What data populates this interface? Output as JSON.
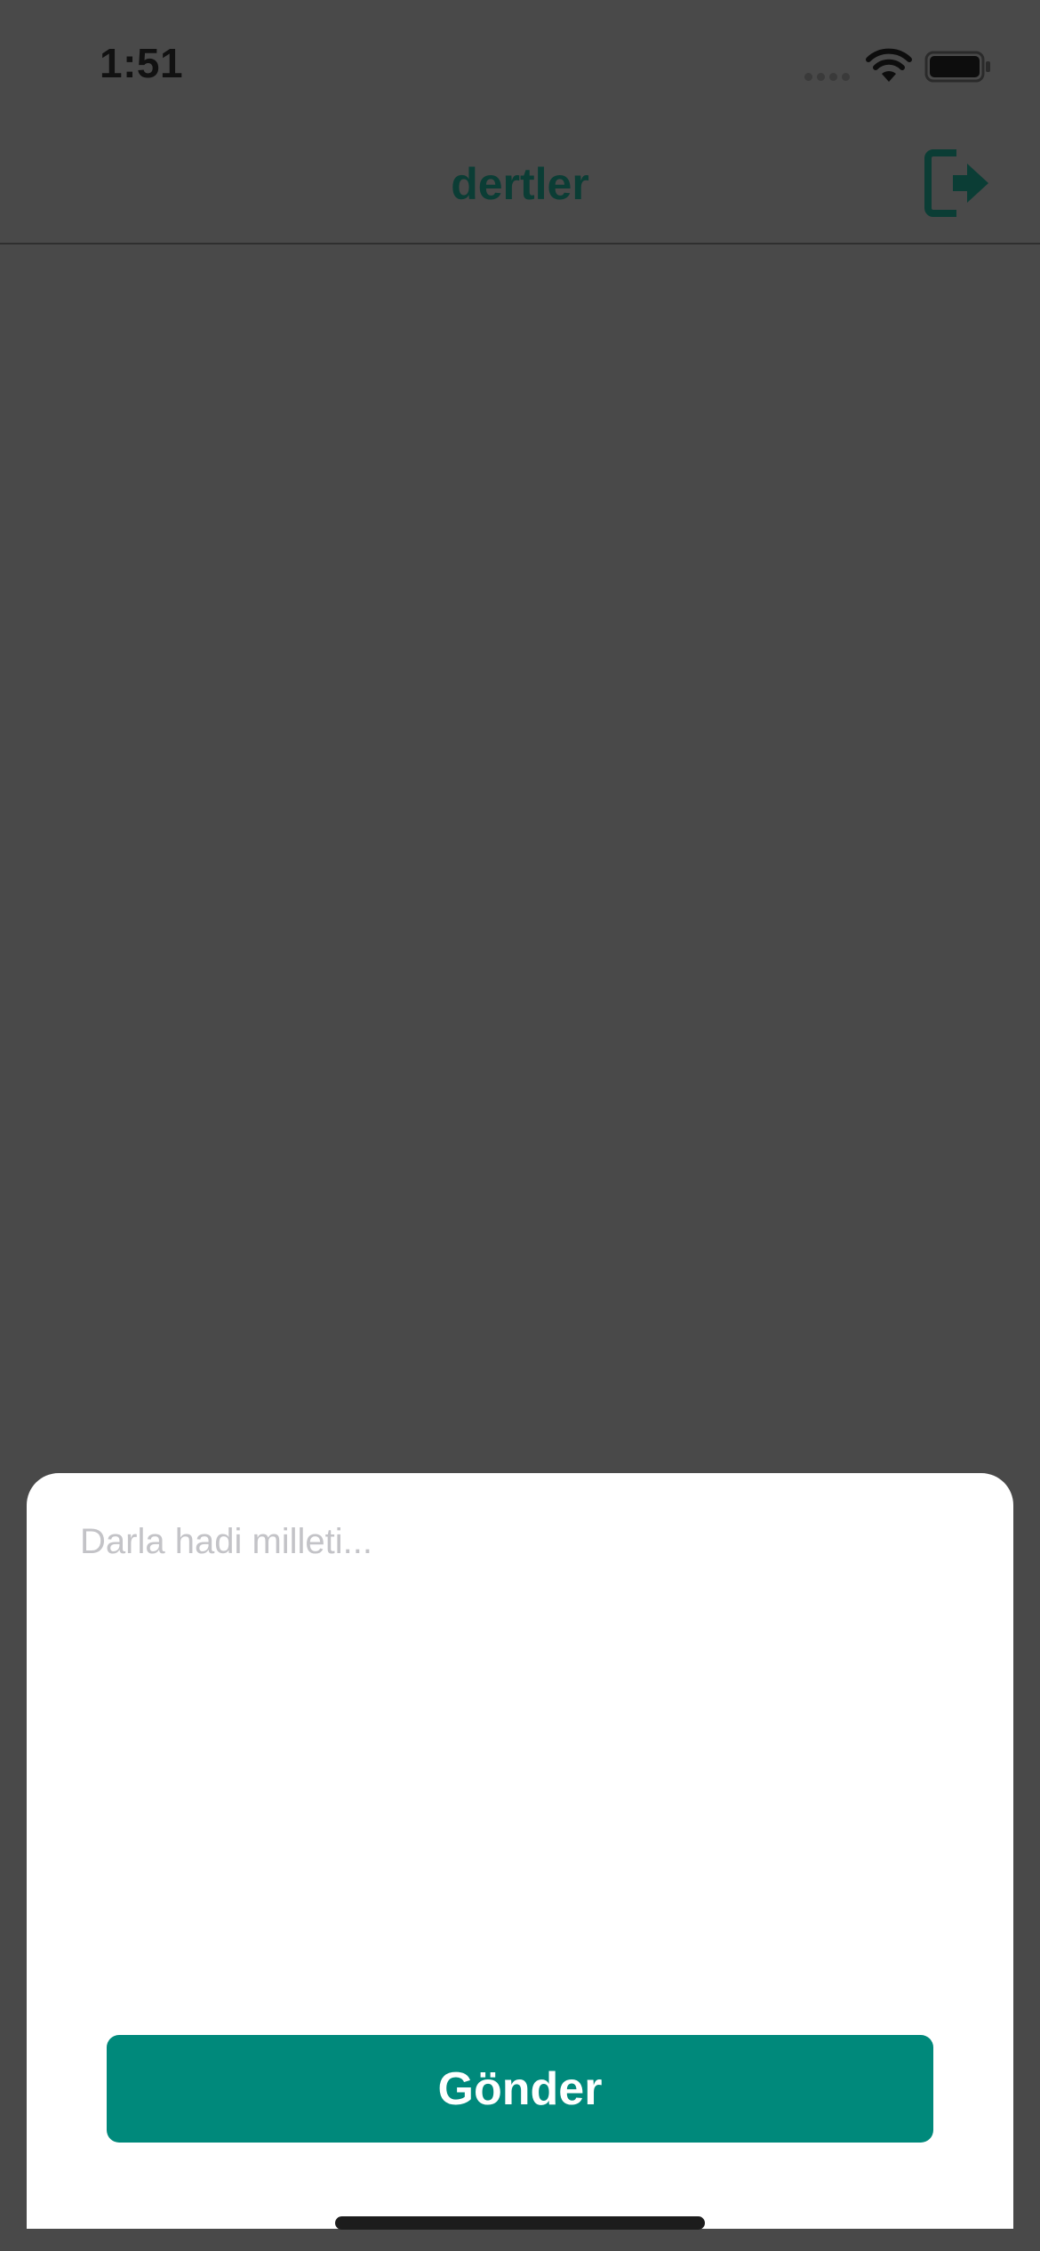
{
  "status_bar": {
    "time": "1:51"
  },
  "nav": {
    "title": "dertler",
    "logout_icon": "logout-icon"
  },
  "composer": {
    "placeholder": "Darla hadi milleti...",
    "value": "",
    "send_label": "Gönder"
  },
  "colors": {
    "accent": "#00897b",
    "title": "#0b3d35",
    "overlay": "#494949",
    "sheet": "#ffffff"
  }
}
